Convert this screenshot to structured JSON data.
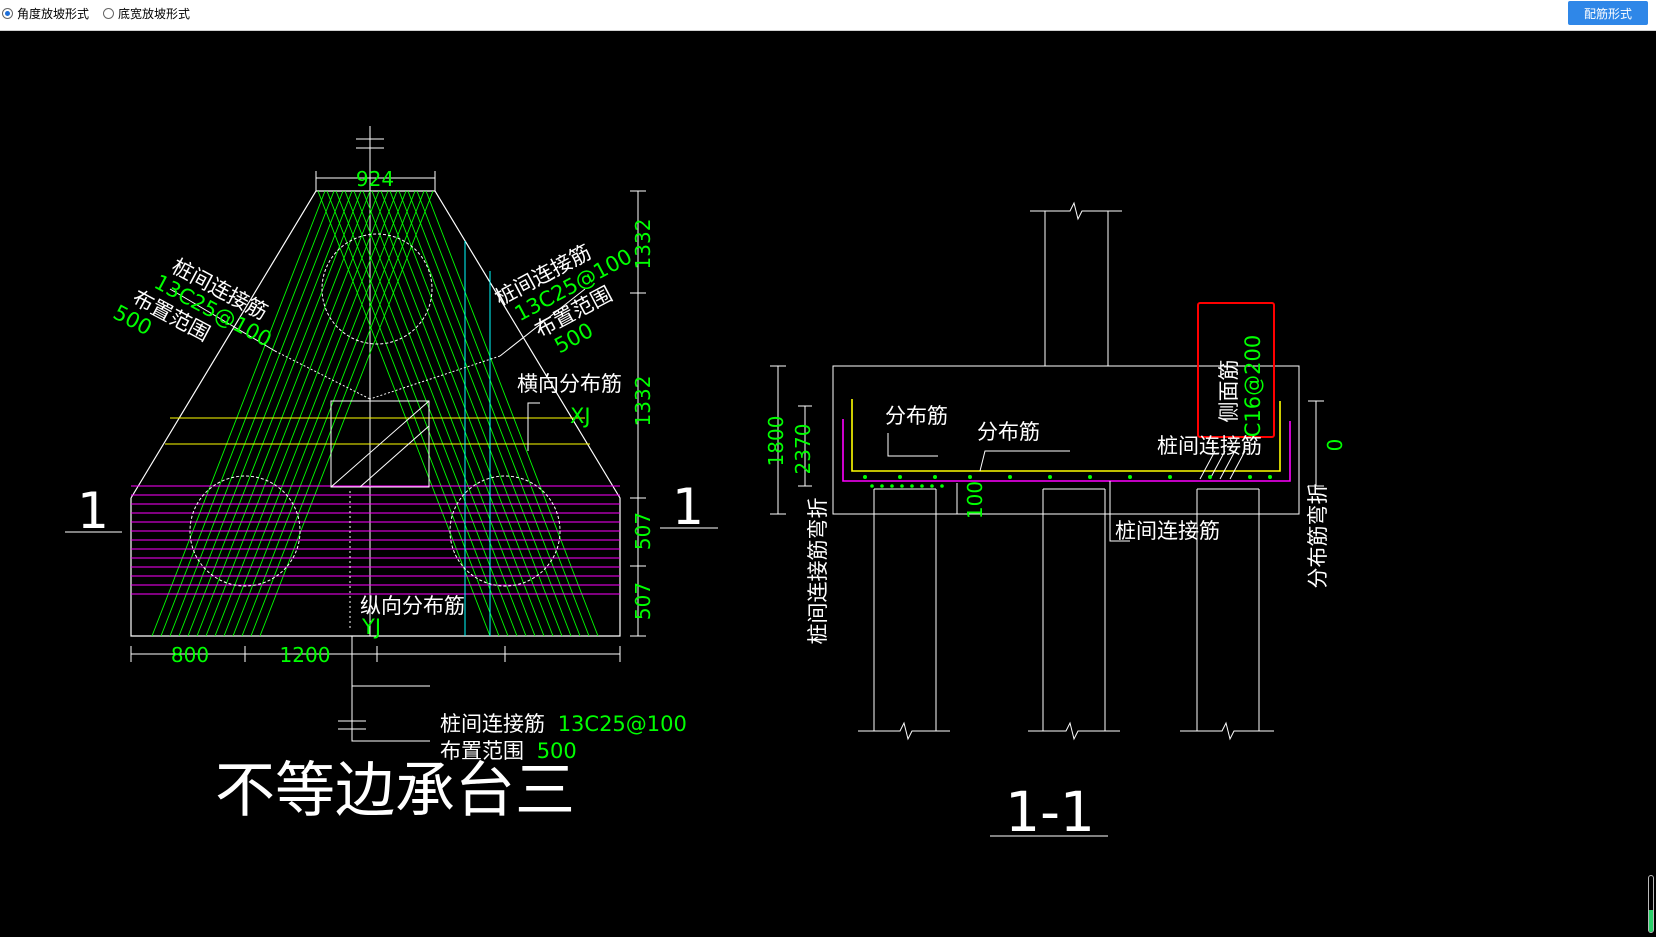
{
  "toolbar": {
    "radio_angle": "角度放坡形式",
    "radio_bottom_width": "底宽放坡形式",
    "rebar_button": "配筋形式"
  },
  "plan": {
    "dim_top": "924",
    "dim_right_1": "1332",
    "dim_right_2": "1332",
    "dim_right_3": "507",
    "dim_right_4": "507",
    "dim_bottom_1": "800",
    "dim_bottom_2": "1200",
    "section_mark_left": "1",
    "section_mark_right": "1",
    "left_label_1": "桩间连接筋",
    "left_label_2": "13C25@100",
    "left_label_3": "布置范围",
    "left_label_4": "500",
    "right_label_1": "桩间连接筋",
    "right_label_2": "13C25@100",
    "right_label_3": "布置范围",
    "right_label_4": "500",
    "transverse_label": "横向分布筋",
    "xj": "XJ",
    "longitudinal_label": "纵向分布筋",
    "yj": "YJ",
    "bottom_label_1": "桩间连接筋",
    "bottom_label_1_val": "13C25@100",
    "bottom_label_2": "布置范围",
    "bottom_label_2_val": "500",
    "title": "不等边承台三"
  },
  "section": {
    "dim_height": "1800",
    "dim_2370": "2370",
    "dim_100": "100",
    "dim_0": "0",
    "distribution_1": "分布筋",
    "distribution_2": "分布筋",
    "connection_top": "桩间连接筋",
    "connection_bottom": "桩间连接筋",
    "side_rebar": "侧面筋",
    "side_rebar_val": "C16@200",
    "left_vertical": "桩间连接筋弯折",
    "right_vertical": "分布筋弯折",
    "title": "1-1"
  },
  "colors": {
    "green": "#00ff00",
    "magenta": "#ff00ff",
    "yellow": "#ffff00",
    "cyan": "#00ffff",
    "red": "#ff0000",
    "accent": "#2f87e8"
  }
}
